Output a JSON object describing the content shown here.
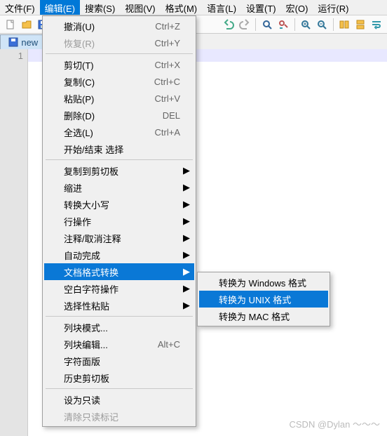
{
  "menubar": [
    {
      "label": "文件(F)"
    },
    {
      "label": "编辑(E)",
      "open": true
    },
    {
      "label": "搜索(S)"
    },
    {
      "label": "视图(V)"
    },
    {
      "label": "格式(M)"
    },
    {
      "label": "语言(L)"
    },
    {
      "label": "设置(T)"
    },
    {
      "label": "宏(O)"
    },
    {
      "label": "运行(R)"
    }
  ],
  "tab": {
    "label": "new",
    "close": "×"
  },
  "gutter": {
    "line1": "1"
  },
  "edit_menu": {
    "groups": [
      [
        {
          "label": "撤消(U)",
          "shortcut": "Ctrl+Z"
        },
        {
          "label": "恢复(R)",
          "shortcut": "Ctrl+Y",
          "disabled": true
        }
      ],
      [
        {
          "label": "剪切(T)",
          "shortcut": "Ctrl+X"
        },
        {
          "label": "复制(C)",
          "shortcut": "Ctrl+C"
        },
        {
          "label": "粘贴(P)",
          "shortcut": "Ctrl+V"
        },
        {
          "label": "删除(D)",
          "shortcut": "DEL"
        },
        {
          "label": "全选(L)",
          "shortcut": "Ctrl+A"
        },
        {
          "label": "开始/结束 选择"
        }
      ],
      [
        {
          "label": "复制到剪切板",
          "submenu": true
        },
        {
          "label": "缩进",
          "submenu": true
        },
        {
          "label": "转换大小写",
          "submenu": true
        },
        {
          "label": "行操作",
          "submenu": true
        },
        {
          "label": "注释/取消注释",
          "submenu": true
        },
        {
          "label": "自动完成",
          "submenu": true
        },
        {
          "label": "文档格式转换",
          "submenu": true,
          "highlight": true
        },
        {
          "label": "空白字符操作",
          "submenu": true
        },
        {
          "label": "选择性粘贴",
          "submenu": true
        }
      ],
      [
        {
          "label": "列块模式..."
        },
        {
          "label": "列块编辑...",
          "shortcut": "Alt+C"
        },
        {
          "label": "字符面版"
        },
        {
          "label": "历史剪切板"
        }
      ],
      [
        {
          "label": "设为只读"
        },
        {
          "label": "清除只读标记",
          "disabled": true
        }
      ]
    ]
  },
  "submenu": {
    "items": [
      {
        "label": "转换为 Windows 格式"
      },
      {
        "label": "转换为 UNIX 格式",
        "highlight": true
      },
      {
        "label": "转换为 MAC 格式"
      }
    ]
  },
  "watermark": "CSDN @Dylan ～～～"
}
